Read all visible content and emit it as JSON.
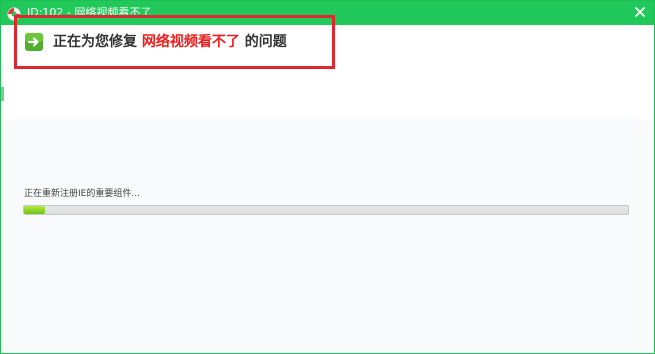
{
  "window": {
    "title": "ID:102 - 网络视频看不了",
    "icon": "lifebuoy-icon",
    "close_icon": "close-icon",
    "accent_color": "#20c95a"
  },
  "header": {
    "arrow_icon": "arrow-right-icon",
    "message_prefix": "正在为您修复",
    "issue_name": "网络视频看不了",
    "message_suffix": "的问题",
    "issue_color": "#ef1c1c",
    "highlight_border_color": "#e0262f"
  },
  "progress": {
    "status_text": "正在重新注册IE的重要组件...",
    "fraction": 0.035
  }
}
